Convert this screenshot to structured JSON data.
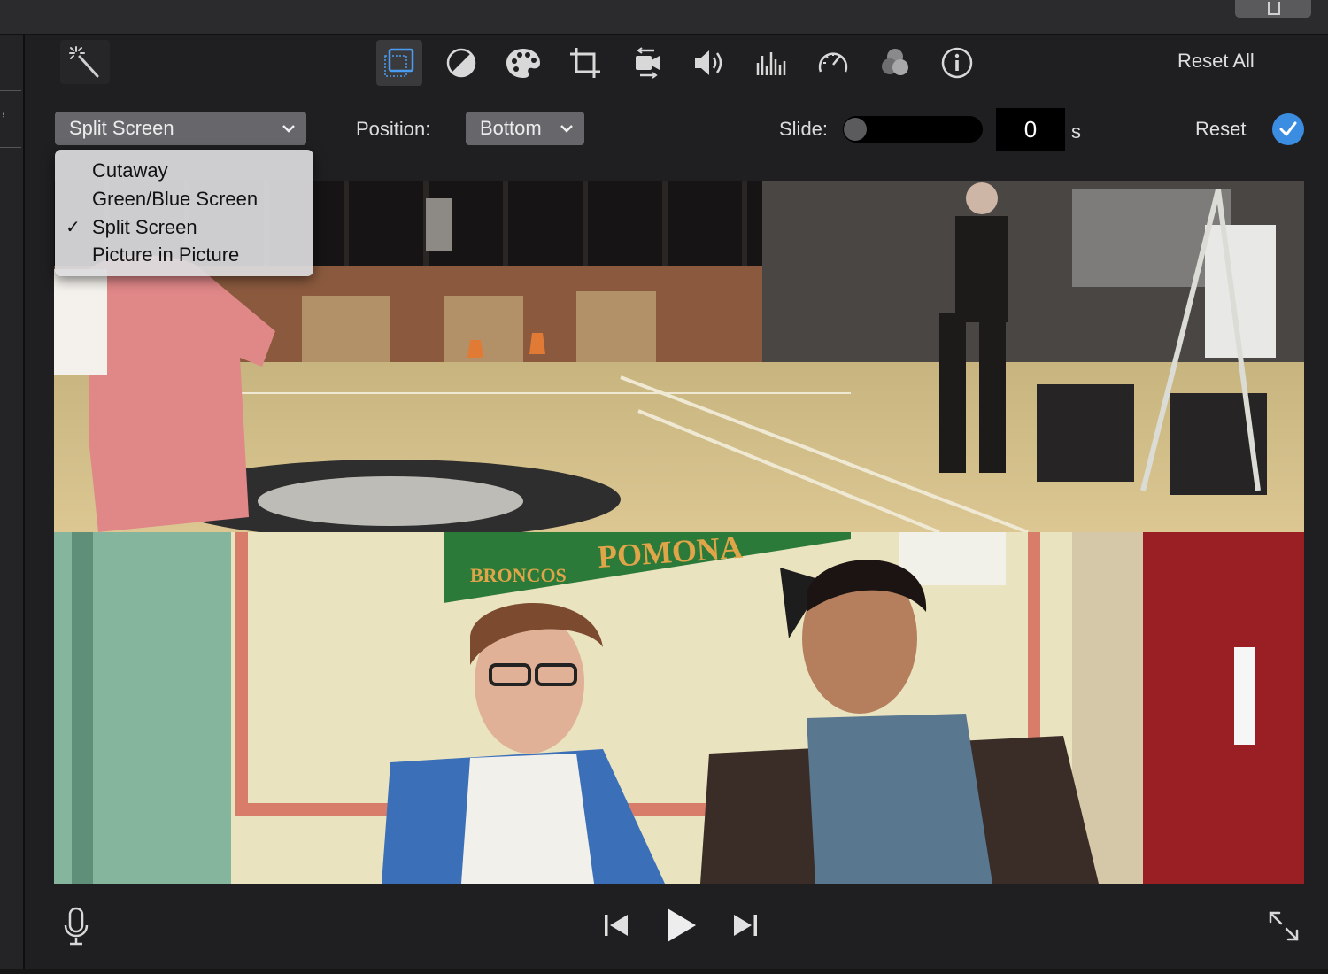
{
  "toolbar": {
    "tools": [
      {
        "name": "video-overlay-settings",
        "icon": "overlay-icon",
        "active": true
      },
      {
        "name": "color-balance",
        "icon": "color-balance-icon"
      },
      {
        "name": "color-correction",
        "icon": "palette-icon"
      },
      {
        "name": "cropping",
        "icon": "crop-icon"
      },
      {
        "name": "stabilization",
        "icon": "camera-stabilization-icon"
      },
      {
        "name": "volume",
        "icon": "speaker-icon"
      },
      {
        "name": "noise-reduction-equalizer",
        "icon": "equalizer-icon"
      },
      {
        "name": "speed",
        "icon": "speedometer-icon"
      },
      {
        "name": "clip-filter",
        "icon": "filter-circles-icon"
      },
      {
        "name": "clip-info",
        "icon": "info-icon"
      }
    ],
    "reset_all_label": "Reset All"
  },
  "overlay": {
    "mode_selected": "Split Screen",
    "position_label": "Position:",
    "position_value": "Bottom",
    "slide_label": "Slide:",
    "slide_value": "0",
    "slide_unit": "s",
    "slide_fraction": 0,
    "reset_label": "Reset"
  },
  "mode_menu": {
    "items": [
      {
        "label": "Cutaway",
        "checked": false
      },
      {
        "label": "Green/Blue Screen",
        "checked": false
      },
      {
        "label": "Split Screen",
        "checked": true
      },
      {
        "label": "Picture in Picture",
        "checked": false
      }
    ],
    "check_glyph": "✓"
  },
  "viewer": {
    "banner_left": "BRONCOS",
    "banner_right": "POMONA"
  },
  "colors": {
    "accent": "#3b8de2",
    "toolbar_bg": "#1f1f21",
    "popup_bg": "#67676b"
  }
}
